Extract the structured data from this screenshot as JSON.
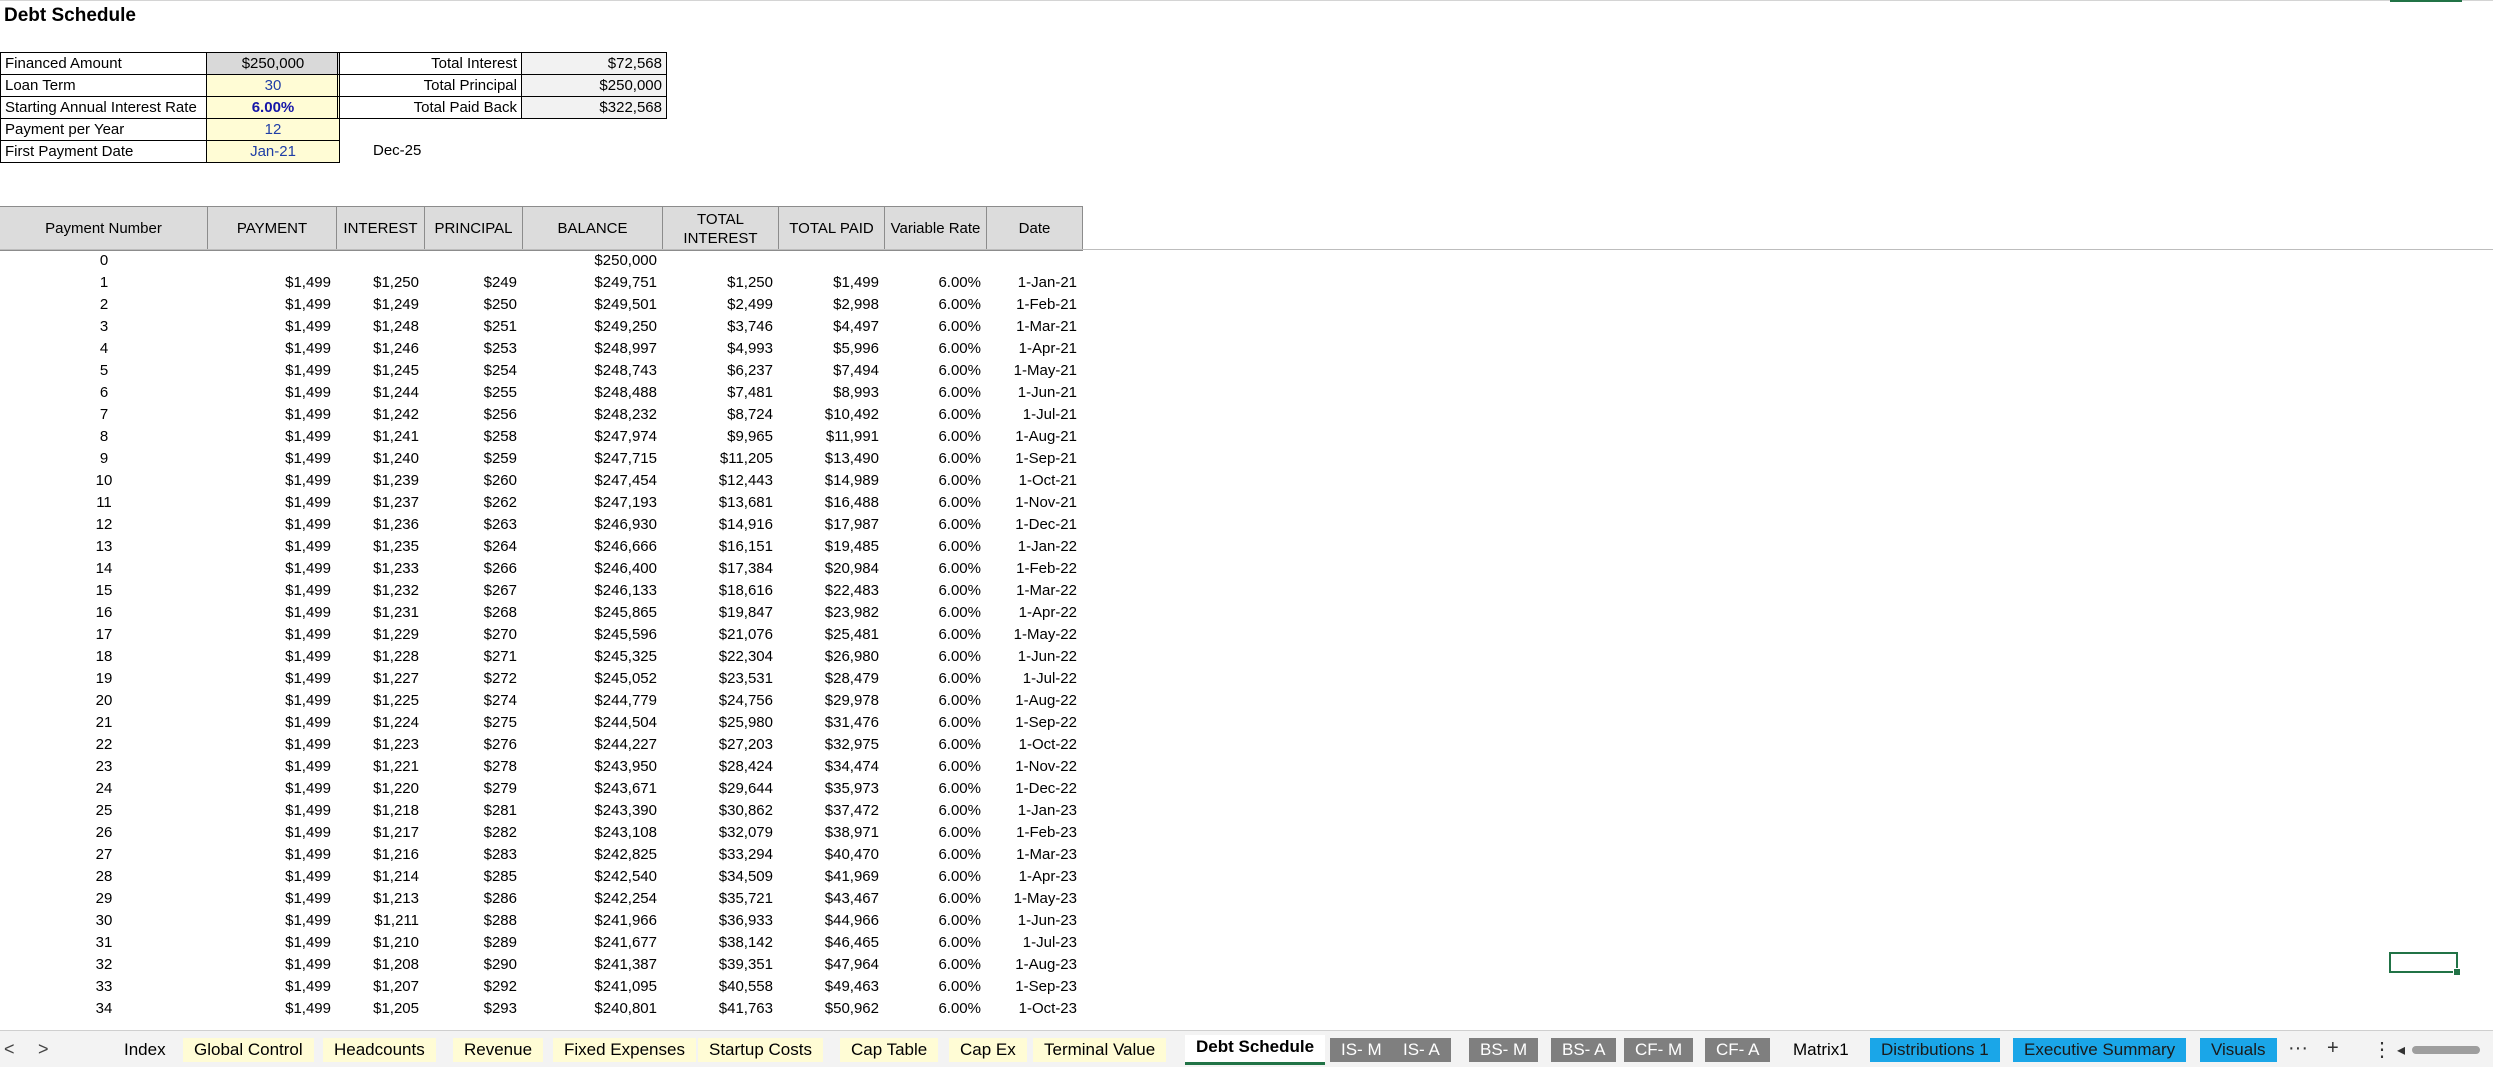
{
  "title": "Debt Schedule",
  "summary_left": [
    {
      "label": "Financed Amount",
      "value": "$250,000"
    },
    {
      "label": "Loan Term",
      "value": "30"
    },
    {
      "label": "Starting Annual Interest Rate",
      "value": "6.00%"
    },
    {
      "label": "Payment per Year",
      "value": "12"
    },
    {
      "label": "First Payment Date",
      "value": "Jan-21"
    }
  ],
  "summary_right": [
    {
      "label": "Total Interest",
      "value": "$72,568"
    },
    {
      "label": "Total Principal",
      "value": "$250,000"
    },
    {
      "label": "Total Paid Back",
      "value": "$322,568"
    }
  ],
  "end_date": "Dec-25",
  "columns": [
    "Payment Number",
    "PAYMENT",
    "INTEREST",
    "PRINCIPAL",
    "BALANCE",
    "TOTAL INTEREST",
    "TOTAL PAID",
    "Variable  Rate",
    "Date"
  ],
  "rows": [
    [
      "0",
      "",
      "",
      "",
      "$250,000",
      "",
      "",
      "",
      ""
    ],
    [
      "1",
      "$1,499",
      "$1,250",
      "$249",
      "$249,751",
      "$1,250",
      "$1,499",
      "6.00%",
      "1-Jan-21"
    ],
    [
      "2",
      "$1,499",
      "$1,249",
      "$250",
      "$249,501",
      "$2,499",
      "$2,998",
      "6.00%",
      "1-Feb-21"
    ],
    [
      "3",
      "$1,499",
      "$1,248",
      "$251",
      "$249,250",
      "$3,746",
      "$4,497",
      "6.00%",
      "1-Mar-21"
    ],
    [
      "4",
      "$1,499",
      "$1,246",
      "$253",
      "$248,997",
      "$4,993",
      "$5,996",
      "6.00%",
      "1-Apr-21"
    ],
    [
      "5",
      "$1,499",
      "$1,245",
      "$254",
      "$248,743",
      "$6,237",
      "$7,494",
      "6.00%",
      "1-May-21"
    ],
    [
      "6",
      "$1,499",
      "$1,244",
      "$255",
      "$248,488",
      "$7,481",
      "$8,993",
      "6.00%",
      "1-Jun-21"
    ],
    [
      "7",
      "$1,499",
      "$1,242",
      "$256",
      "$248,232",
      "$8,724",
      "$10,492",
      "6.00%",
      "1-Jul-21"
    ],
    [
      "8",
      "$1,499",
      "$1,241",
      "$258",
      "$247,974",
      "$9,965",
      "$11,991",
      "6.00%",
      "1-Aug-21"
    ],
    [
      "9",
      "$1,499",
      "$1,240",
      "$259",
      "$247,715",
      "$11,205",
      "$13,490",
      "6.00%",
      "1-Sep-21"
    ],
    [
      "10",
      "$1,499",
      "$1,239",
      "$260",
      "$247,454",
      "$12,443",
      "$14,989",
      "6.00%",
      "1-Oct-21"
    ],
    [
      "11",
      "$1,499",
      "$1,237",
      "$262",
      "$247,193",
      "$13,681",
      "$16,488",
      "6.00%",
      "1-Nov-21"
    ],
    [
      "12",
      "$1,499",
      "$1,236",
      "$263",
      "$246,930",
      "$14,916",
      "$17,987",
      "6.00%",
      "1-Dec-21"
    ],
    [
      "13",
      "$1,499",
      "$1,235",
      "$264",
      "$246,666",
      "$16,151",
      "$19,485",
      "6.00%",
      "1-Jan-22"
    ],
    [
      "14",
      "$1,499",
      "$1,233",
      "$266",
      "$246,400",
      "$17,384",
      "$20,984",
      "6.00%",
      "1-Feb-22"
    ],
    [
      "15",
      "$1,499",
      "$1,232",
      "$267",
      "$246,133",
      "$18,616",
      "$22,483",
      "6.00%",
      "1-Mar-22"
    ],
    [
      "16",
      "$1,499",
      "$1,231",
      "$268",
      "$245,865",
      "$19,847",
      "$23,982",
      "6.00%",
      "1-Apr-22"
    ],
    [
      "17",
      "$1,499",
      "$1,229",
      "$270",
      "$245,596",
      "$21,076",
      "$25,481",
      "6.00%",
      "1-May-22"
    ],
    [
      "18",
      "$1,499",
      "$1,228",
      "$271",
      "$245,325",
      "$22,304",
      "$26,980",
      "6.00%",
      "1-Jun-22"
    ],
    [
      "19",
      "$1,499",
      "$1,227",
      "$272",
      "$245,052",
      "$23,531",
      "$28,479",
      "6.00%",
      "1-Jul-22"
    ],
    [
      "20",
      "$1,499",
      "$1,225",
      "$274",
      "$244,779",
      "$24,756",
      "$29,978",
      "6.00%",
      "1-Aug-22"
    ],
    [
      "21",
      "$1,499",
      "$1,224",
      "$275",
      "$244,504",
      "$25,980",
      "$31,476",
      "6.00%",
      "1-Sep-22"
    ],
    [
      "22",
      "$1,499",
      "$1,223",
      "$276",
      "$244,227",
      "$27,203",
      "$32,975",
      "6.00%",
      "1-Oct-22"
    ],
    [
      "23",
      "$1,499",
      "$1,221",
      "$278",
      "$243,950",
      "$28,424",
      "$34,474",
      "6.00%",
      "1-Nov-22"
    ],
    [
      "24",
      "$1,499",
      "$1,220",
      "$279",
      "$243,671",
      "$29,644",
      "$35,973",
      "6.00%",
      "1-Dec-22"
    ],
    [
      "25",
      "$1,499",
      "$1,218",
      "$281",
      "$243,390",
      "$30,862",
      "$37,472",
      "6.00%",
      "1-Jan-23"
    ],
    [
      "26",
      "$1,499",
      "$1,217",
      "$282",
      "$243,108",
      "$32,079",
      "$38,971",
      "6.00%",
      "1-Feb-23"
    ],
    [
      "27",
      "$1,499",
      "$1,216",
      "$283",
      "$242,825",
      "$33,294",
      "$40,470",
      "6.00%",
      "1-Mar-23"
    ],
    [
      "28",
      "$1,499",
      "$1,214",
      "$285",
      "$242,540",
      "$34,509",
      "$41,969",
      "6.00%",
      "1-Apr-23"
    ],
    [
      "29",
      "$1,499",
      "$1,213",
      "$286",
      "$242,254",
      "$35,721",
      "$43,467",
      "6.00%",
      "1-May-23"
    ],
    [
      "30",
      "$1,499",
      "$1,211",
      "$288",
      "$241,966",
      "$36,933",
      "$44,966",
      "6.00%",
      "1-Jun-23"
    ],
    [
      "31",
      "$1,499",
      "$1,210",
      "$289",
      "$241,677",
      "$38,142",
      "$46,465",
      "6.00%",
      "1-Jul-23"
    ],
    [
      "32",
      "$1,499",
      "$1,208",
      "$290",
      "$241,387",
      "$39,351",
      "$47,964",
      "6.00%",
      "1-Aug-23"
    ],
    [
      "33",
      "$1,499",
      "$1,207",
      "$292",
      "$241,095",
      "$40,558",
      "$49,463",
      "6.00%",
      "1-Sep-23"
    ],
    [
      "34",
      "$1,499",
      "$1,205",
      "$293",
      "$240,801",
      "$41,763",
      "$50,962",
      "6.00%",
      "1-Oct-23"
    ]
  ],
  "tabs": [
    {
      "label": "Index",
      "style": "plain"
    },
    {
      "label": "Global Control",
      "style": "yellow"
    },
    {
      "label": "Headcounts",
      "style": "yellow"
    },
    {
      "label": "Revenue",
      "style": "yellow"
    },
    {
      "label": "Fixed Expenses",
      "style": "yellow"
    },
    {
      "label": "Startup Costs",
      "style": "yellow"
    },
    {
      "label": "Cap Table",
      "style": "yellow"
    },
    {
      "label": "Cap Ex",
      "style": "yellow"
    },
    {
      "label": "Terminal Value",
      "style": "yellow"
    },
    {
      "label": "Debt Schedule",
      "style": "active"
    },
    {
      "label": "IS- M",
      "style": "gray"
    },
    {
      "label": "IS- A",
      "style": "gray"
    },
    {
      "label": "BS- M",
      "style": "gray"
    },
    {
      "label": "BS- A",
      "style": "gray"
    },
    {
      "label": "CF- M",
      "style": "gray"
    },
    {
      "label": "CF- A",
      "style": "gray"
    },
    {
      "label": "Matrix1",
      "style": "plain"
    },
    {
      "label": "Distributions 1",
      "style": "blue"
    },
    {
      "label": "Executive Summary",
      "style": "blue"
    },
    {
      "label": "Visuals",
      "style": "blue"
    }
  ],
  "tab_tools": {
    "more": "···",
    "add": "+",
    "options": "⋮",
    "prev": "<",
    "next": ">",
    "scroll_left": "◂"
  },
  "colors": {
    "input_fill": "#fffcd5",
    "header_fill": "#dcdcdc",
    "selection": "#217346",
    "tab_blue": "#1aa6e8",
    "tab_gray": "#7f7f7f"
  }
}
